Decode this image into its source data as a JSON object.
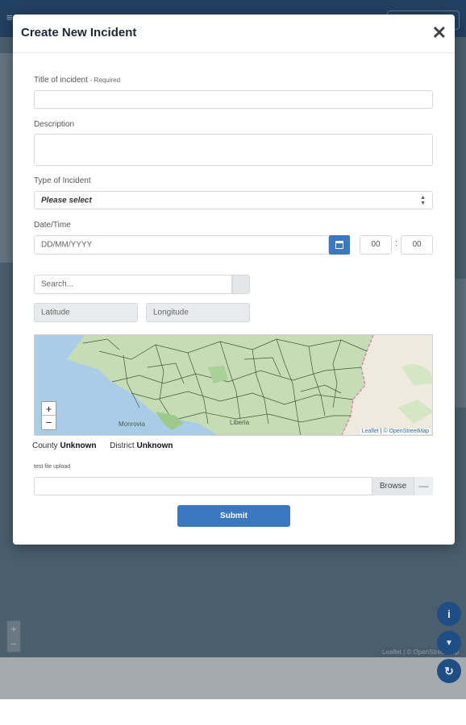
{
  "background": {
    "menu_glyph": "≡",
    "app_zoom": {
      "in": "+",
      "out": "−"
    },
    "attribution": "Leaflet | © OpenStreetMap",
    "fabs": [
      {
        "icon": "info-icon",
        "glyph": "i"
      },
      {
        "icon": "filter-icon",
        "glyph": "▼"
      },
      {
        "icon": "refresh-icon",
        "glyph": "↻"
      }
    ]
  },
  "modal": {
    "title": "Create New Incident",
    "close_glyph": "✕",
    "title_field": {
      "label": "Title of incident",
      "required_note": "- Required",
      "value": ""
    },
    "description": {
      "label": "Description",
      "value": ""
    },
    "type": {
      "label": "Type of Incident",
      "selected": "Please select"
    },
    "datetime": {
      "label": "Date/Time",
      "date_placeholder": "DD/MM/YYYY",
      "hour": "00",
      "separator": ":",
      "minute": "00"
    },
    "location": {
      "search_placeholder": "Search...",
      "latitude_placeholder": "Latitude",
      "longitude_placeholder": "Longitude"
    },
    "map": {
      "zoom_in": "+",
      "zoom_out": "−",
      "attribution_leaflet": "Leaflet",
      "attribution_osm": "© OpenStreetMap",
      "labels": [
        "Liberia",
        "Monrovia"
      ]
    },
    "county": {
      "label": "County",
      "value": "Unknown"
    },
    "district": {
      "label": "District",
      "value": "Unknown"
    },
    "upload": {
      "label": "test file upload",
      "browse_label": "Browse",
      "remove_glyph": "—"
    },
    "submit_label": "Submit"
  },
  "colors": {
    "primary": "#3a78c2",
    "topbar": "#1f4670",
    "fab": "#1f4e85"
  }
}
